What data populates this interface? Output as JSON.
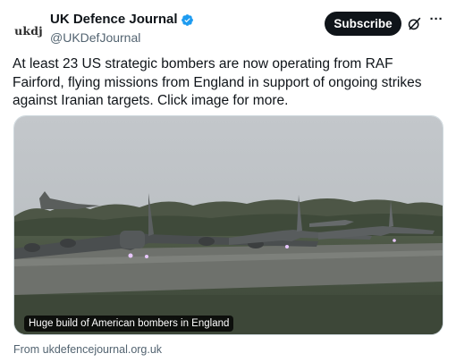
{
  "account": {
    "avatar_text": "ukdj",
    "display_name": "UK Defence Journal",
    "handle": "@UKDefJournal",
    "verified_color": "#1d9bf0"
  },
  "actions": {
    "subscribe_label": "Subscribe",
    "grok_icon": "grok-icon",
    "more_icon": "more-icon"
  },
  "tweet": {
    "text": "At least 23 US strategic bombers are now operating from RAF Fairford, flying missions from England in support of ongoing strikes against Iranian targets. Click image for more."
  },
  "media": {
    "caption": "Huge build of American bombers in England",
    "source": "From ukdefencejournal.org.uk"
  }
}
